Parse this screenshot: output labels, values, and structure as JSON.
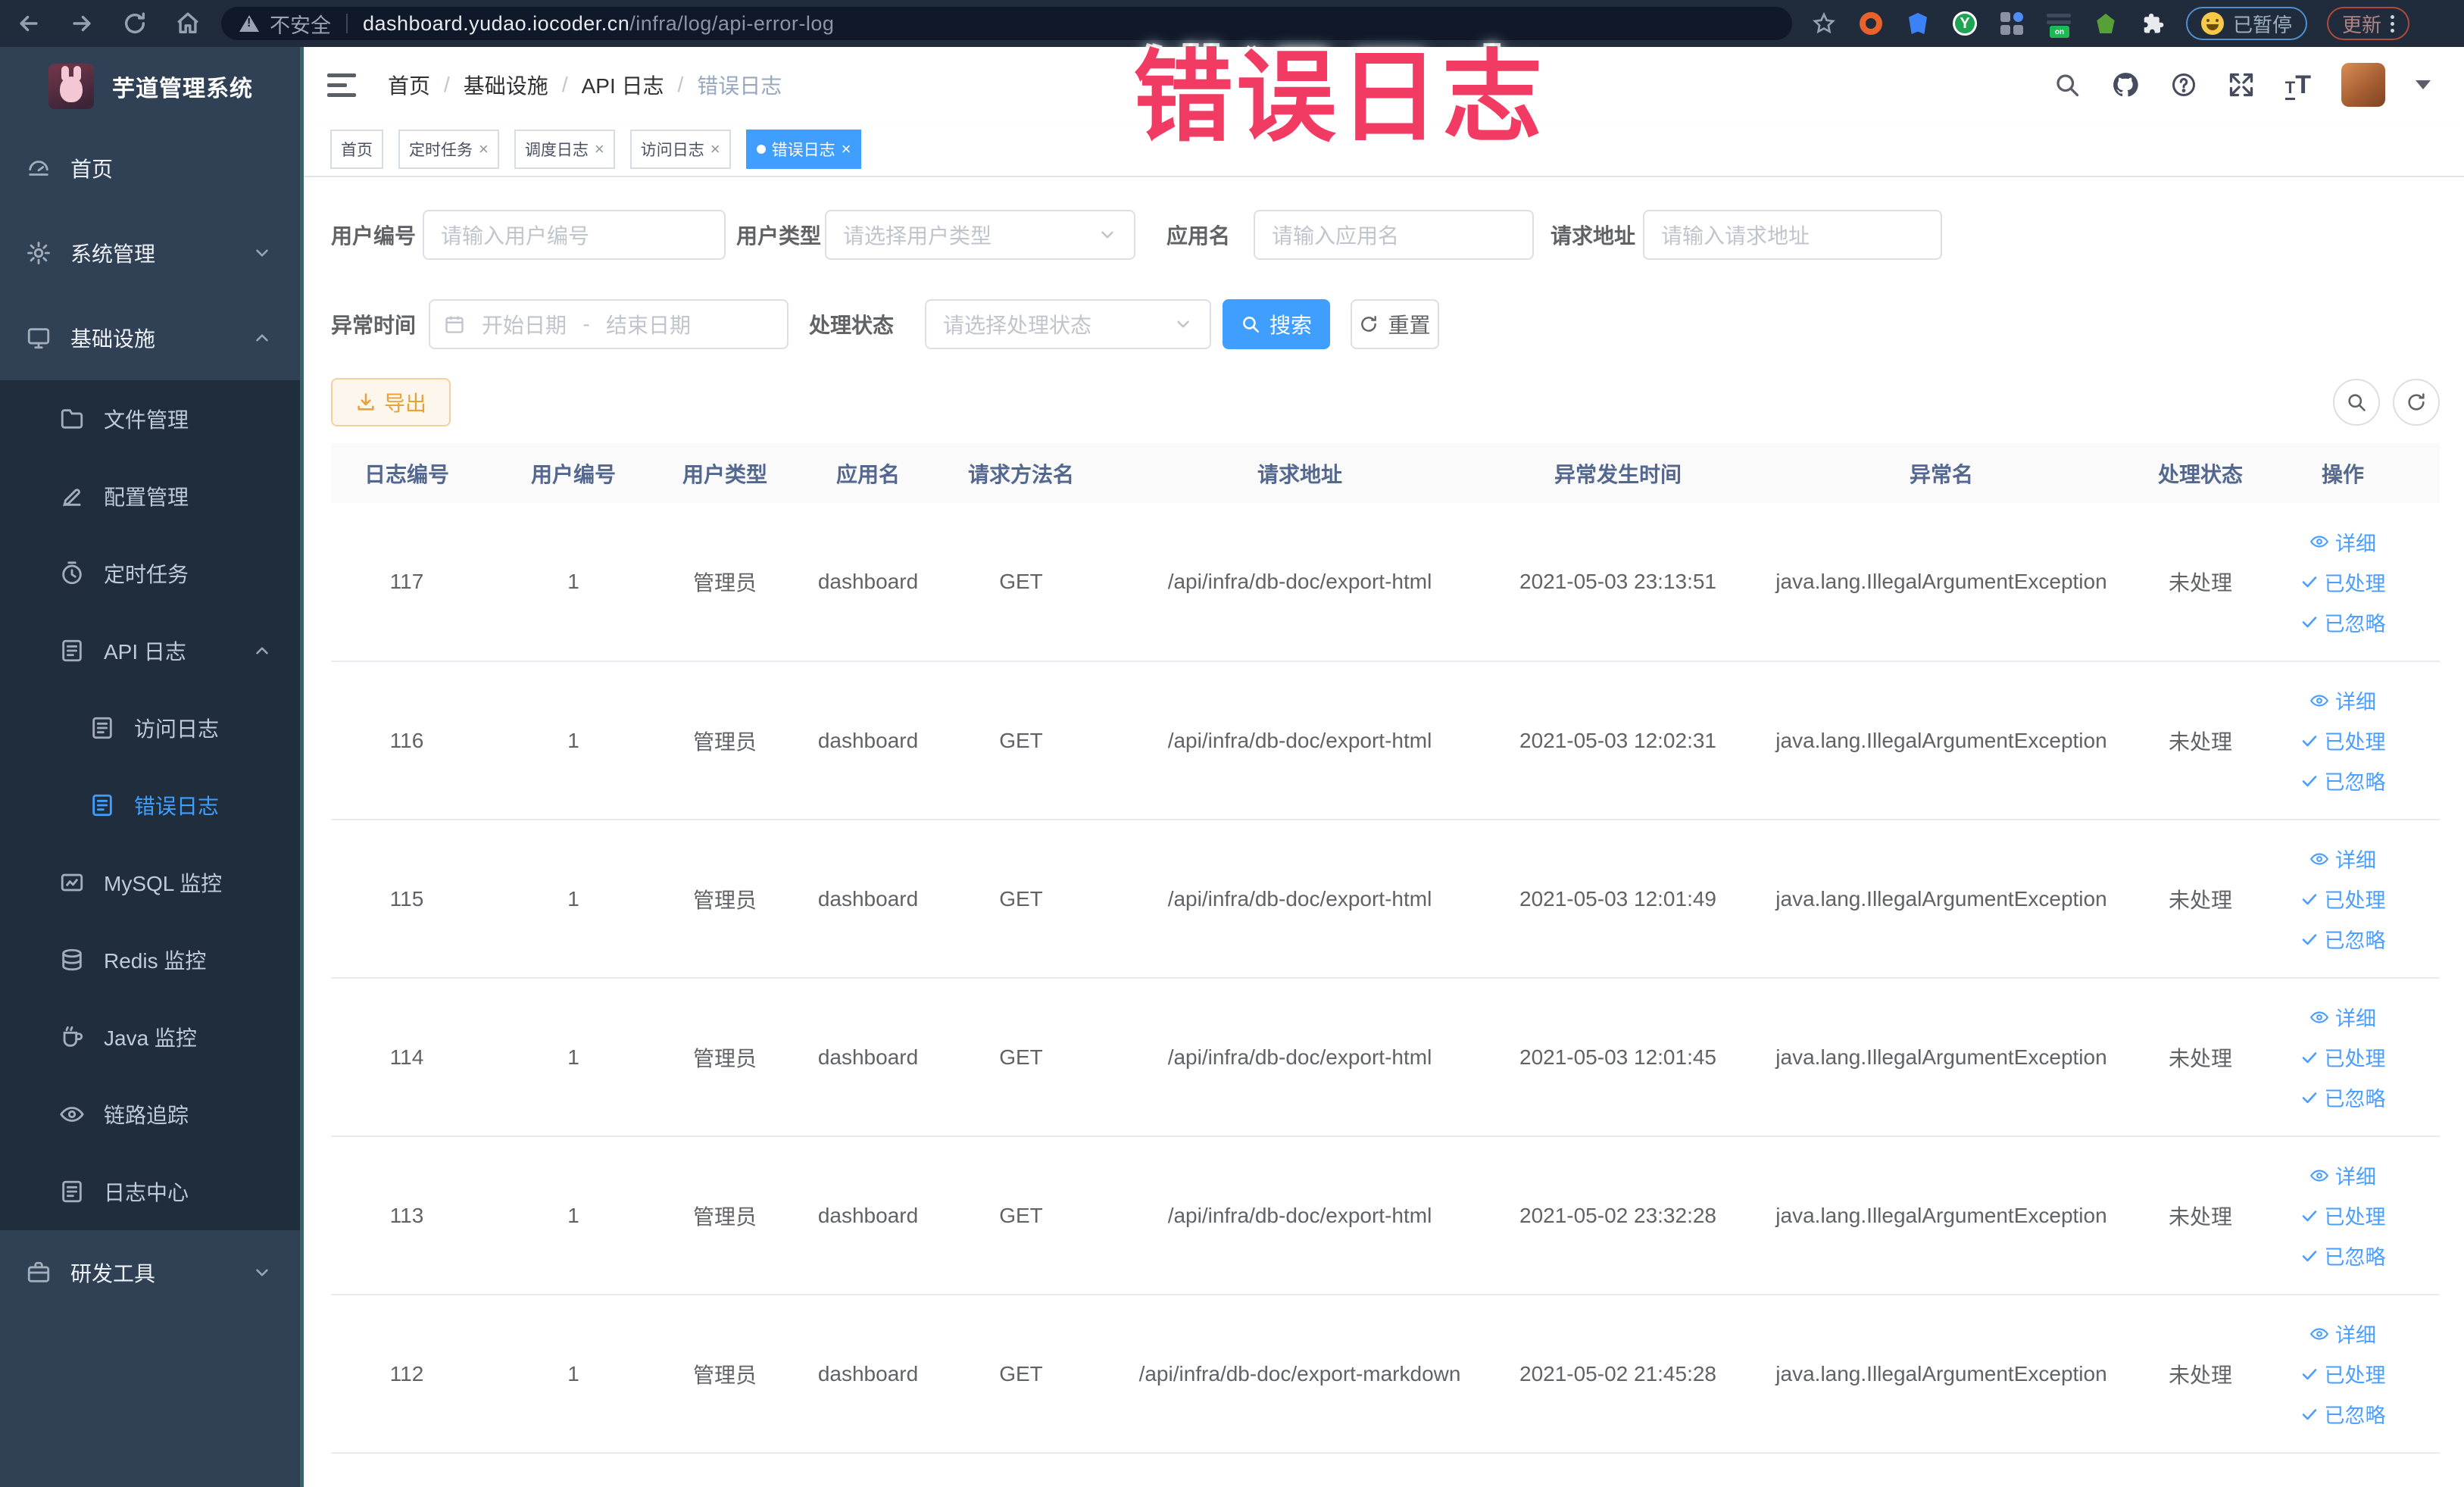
{
  "browser": {
    "security_label": "不安全",
    "url_domain": "dashboard.yudao.iocoder.cn",
    "url_path": "/infra/log/api-error-log",
    "paused_label": "已暂停",
    "update_label": "更新"
  },
  "annotation": {
    "text": "错误日志",
    "color": "#f23b62"
  },
  "sidebar": {
    "title": "芋道管理系统",
    "items": [
      {
        "label": "首页",
        "level": 1,
        "icon": "dashboard-icon",
        "chevron": "",
        "active": false
      },
      {
        "label": "系统管理",
        "level": 1,
        "icon": "gear-icon",
        "chevron": "down",
        "active": false
      },
      {
        "label": "基础设施",
        "level": 1,
        "icon": "monitor-icon",
        "chevron": "up",
        "active": false
      },
      {
        "label": "文件管理",
        "level": 2,
        "icon": "folder-icon",
        "chevron": "",
        "active": false
      },
      {
        "label": "配置管理",
        "level": 2,
        "icon": "edit-icon",
        "chevron": "",
        "active": false
      },
      {
        "label": "定时任务",
        "level": 2,
        "icon": "timer-icon",
        "chevron": "",
        "active": false
      },
      {
        "label": "API 日志",
        "level": 2,
        "icon": "log-icon",
        "chevron": "up",
        "active": false
      },
      {
        "label": "访问日志",
        "level": 3,
        "icon": "log-icon",
        "chevron": "",
        "active": false
      },
      {
        "label": "错误日志",
        "level": 3,
        "icon": "log-icon",
        "chevron": "",
        "active": true
      },
      {
        "label": "MySQL 监控",
        "level": 2,
        "icon": "screen-icon",
        "chevron": "",
        "active": false
      },
      {
        "label": "Redis 监控",
        "level": 2,
        "icon": "db-icon",
        "chevron": "",
        "active": false
      },
      {
        "label": "Java 监控",
        "level": 2,
        "icon": "cup-icon",
        "chevron": "",
        "active": false
      },
      {
        "label": "链路追踪",
        "level": 2,
        "icon": "eye-icon",
        "chevron": "",
        "active": false
      },
      {
        "label": "日志中心",
        "level": 2,
        "icon": "log-icon",
        "chevron": "",
        "active": false
      },
      {
        "label": "研发工具",
        "level": 1,
        "icon": "tools-icon",
        "chevron": "down",
        "active": false
      }
    ]
  },
  "breadcrumb": [
    "首页",
    "基础设施",
    "API 日志",
    "错误日志"
  ],
  "tabs": [
    {
      "label": "首页",
      "closable": false,
      "active": false
    },
    {
      "label": "定时任务",
      "closable": true,
      "active": false
    },
    {
      "label": "调度日志",
      "closable": true,
      "active": false
    },
    {
      "label": "访问日志",
      "closable": true,
      "active": false
    },
    {
      "label": "错误日志",
      "closable": true,
      "active": true
    }
  ],
  "filters": {
    "user_id": {
      "label": "用户编号",
      "placeholder": "请输入用户编号"
    },
    "user_type": {
      "label": "用户类型",
      "placeholder": "请选择用户类型"
    },
    "app_name": {
      "label": "应用名",
      "placeholder": "请输入应用名"
    },
    "request_url": {
      "label": "请求地址",
      "placeholder": "请输入请求地址"
    },
    "exception_time": {
      "label": "异常时间",
      "start_placeholder": "开始日期",
      "separator": "-",
      "end_placeholder": "结束日期"
    },
    "process_status": {
      "label": "处理状态",
      "placeholder": "请选择处理状态"
    },
    "search_label": "搜索",
    "reset_label": "重置"
  },
  "toolbar": {
    "export_label": "导出"
  },
  "table": {
    "columns": [
      "日志编号",
      "用户编号",
      "用户类型",
      "应用名",
      "请求方法名",
      "请求地址",
      "异常发生时间",
      "异常名",
      "处理状态",
      "操作"
    ],
    "op_labels": {
      "detail": "详细",
      "processed": "已处理",
      "ignored": "已忽略"
    },
    "rows": [
      {
        "id": "117",
        "user_id": "1",
        "user_type": "管理员",
        "app": "dashboard",
        "method": "GET",
        "url": "/api/infra/db-doc/export-html",
        "time": "2021-05-03 23:13:51",
        "exception": "java.lang.IllegalArgumentException",
        "status": "未处理"
      },
      {
        "id": "116",
        "user_id": "1",
        "user_type": "管理员",
        "app": "dashboard",
        "method": "GET",
        "url": "/api/infra/db-doc/export-html",
        "time": "2021-05-03 12:02:31",
        "exception": "java.lang.IllegalArgumentException",
        "status": "未处理"
      },
      {
        "id": "115",
        "user_id": "1",
        "user_type": "管理员",
        "app": "dashboard",
        "method": "GET",
        "url": "/api/infra/db-doc/export-html",
        "time": "2021-05-03 12:01:49",
        "exception": "java.lang.IllegalArgumentException",
        "status": "未处理"
      },
      {
        "id": "114",
        "user_id": "1",
        "user_type": "管理员",
        "app": "dashboard",
        "method": "GET",
        "url": "/api/infra/db-doc/export-html",
        "time": "2021-05-03 12:01:45",
        "exception": "java.lang.IllegalArgumentException",
        "status": "未处理"
      },
      {
        "id": "113",
        "user_id": "1",
        "user_type": "管理员",
        "app": "dashboard",
        "method": "GET",
        "url": "/api/infra/db-doc/export-html",
        "time": "2021-05-02 23:32:28",
        "exception": "java.lang.IllegalArgumentException",
        "status": "未处理"
      },
      {
        "id": "112",
        "user_id": "1",
        "user_type": "管理员",
        "app": "dashboard",
        "method": "GET",
        "url": "/api/infra/db-doc/export-markdown",
        "time": "2021-05-02 21:45:28",
        "exception": "java.lang.IllegalArgumentException",
        "status": "未处理"
      }
    ]
  },
  "colors": {
    "accent": "#409eff",
    "warning": "#e6a23c",
    "sidebar_bg": "#304156",
    "submenu_bg": "#1f2d3d"
  }
}
